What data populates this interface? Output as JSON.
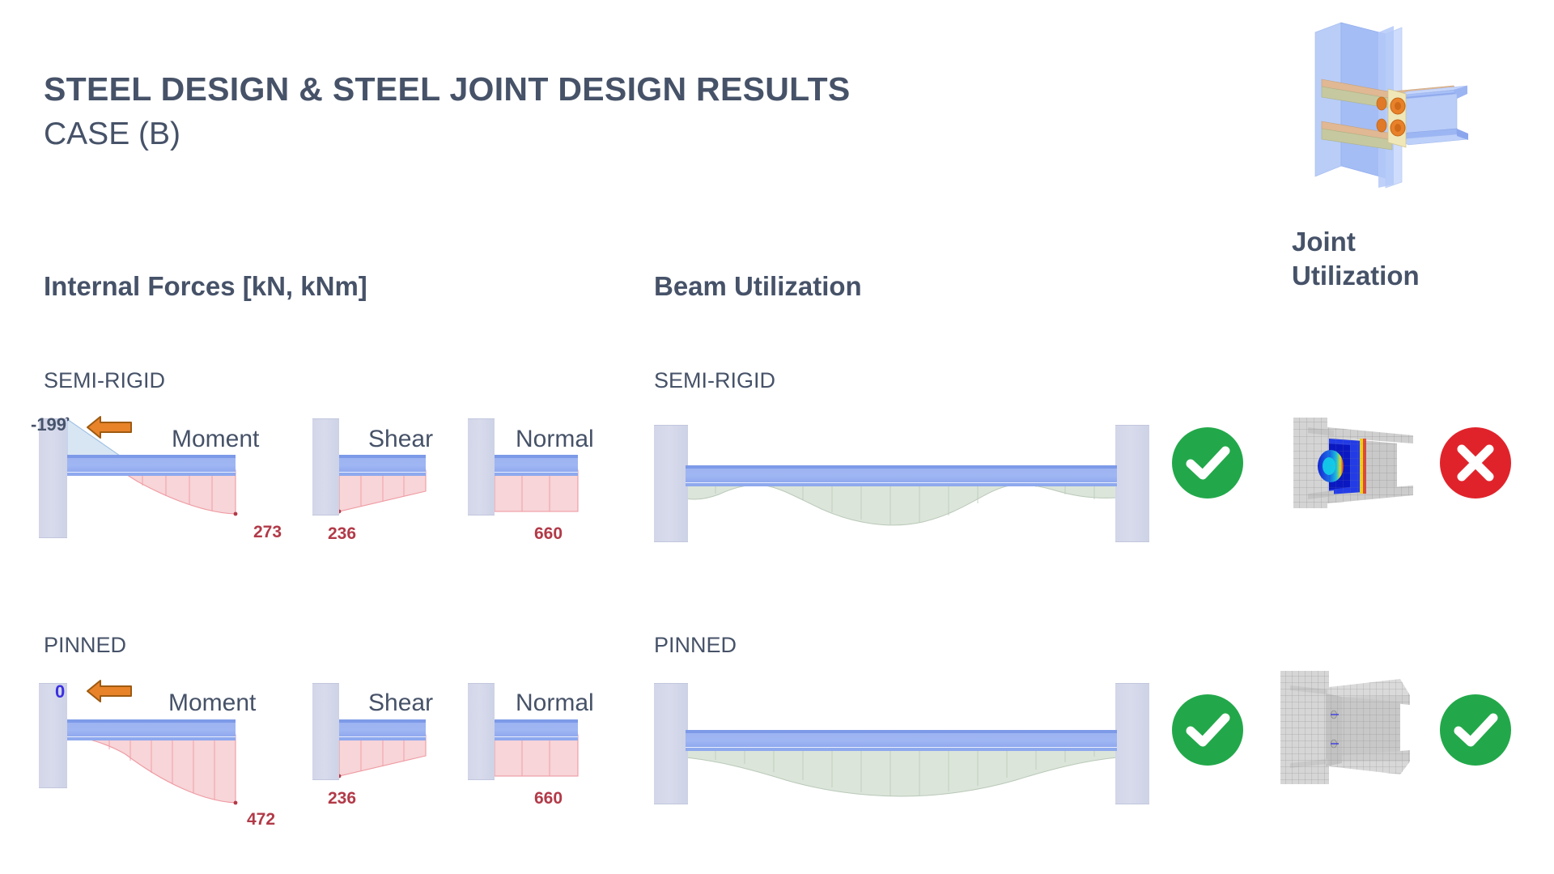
{
  "header": {
    "title": "STEEL DESIGN & STEEL JOINT DESIGN RESULTS",
    "subtitle": "CASE (B)"
  },
  "columns": {
    "internal_forces": "Internal Forces [kN, kNm]",
    "beam_utilization": "Beam Utilization",
    "joint_utilization_line1": "Joint",
    "joint_utilization_line2": "Utilization"
  },
  "rows": [
    {
      "id": "semi-rigid",
      "label": "SEMI-RIGID",
      "support_moment": "-199",
      "diagrams": [
        {
          "name": "Moment",
          "peak": "273"
        },
        {
          "name": "Shear",
          "peak": "236"
        },
        {
          "name": "Normal",
          "peak": "660"
        }
      ],
      "beam_status": "pass",
      "joint_status": "fail"
    },
    {
      "id": "pinned",
      "label": "PINNED",
      "support_moment": "0",
      "diagrams": [
        {
          "name": "Moment",
          "peak": "472"
        },
        {
          "name": "Shear",
          "peak": "236"
        },
        {
          "name": "Normal",
          "peak": "660"
        }
      ],
      "beam_status": "pass",
      "joint_status": "pass"
    }
  ],
  "colors": {
    "text_dark": "#465268",
    "value_red": "#b23a48",
    "zero_blue": "#3a2fe0",
    "arrow_orange": "#e8832a",
    "pass_green": "#22a84a",
    "fail_red": "#e0232b",
    "beam_blue": "#9db4f2",
    "column_lilac": "#d2d6e8",
    "moment_fill": "#f6d3d6",
    "utilization_green": "#dbe5da"
  },
  "chart_data": [
    {
      "type": "area",
      "title": "SEMI-RIGID Moment",
      "ylabel": "kNm",
      "annotations": [
        "-199",
        "273"
      ],
      "support_value": -199,
      "span_peak": 273
    },
    {
      "type": "area",
      "title": "SEMI-RIGID Shear",
      "ylabel": "kN",
      "annotations": [
        "236"
      ],
      "support_value": 236
    },
    {
      "type": "area",
      "title": "SEMI-RIGID Normal",
      "ylabel": "kN",
      "annotations": [
        "660"
      ],
      "constant_value": 660
    },
    {
      "type": "area",
      "title": "PINNED Moment",
      "ylabel": "kNm",
      "annotations": [
        "0",
        "472"
      ],
      "support_value": 0,
      "span_peak": 472
    },
    {
      "type": "area",
      "title": "PINNED Shear",
      "ylabel": "kN",
      "annotations": [
        "236"
      ],
      "support_value": 236
    },
    {
      "type": "area",
      "title": "PINNED Normal",
      "ylabel": "kN",
      "annotations": [
        "660"
      ],
      "constant_value": 660
    }
  ]
}
